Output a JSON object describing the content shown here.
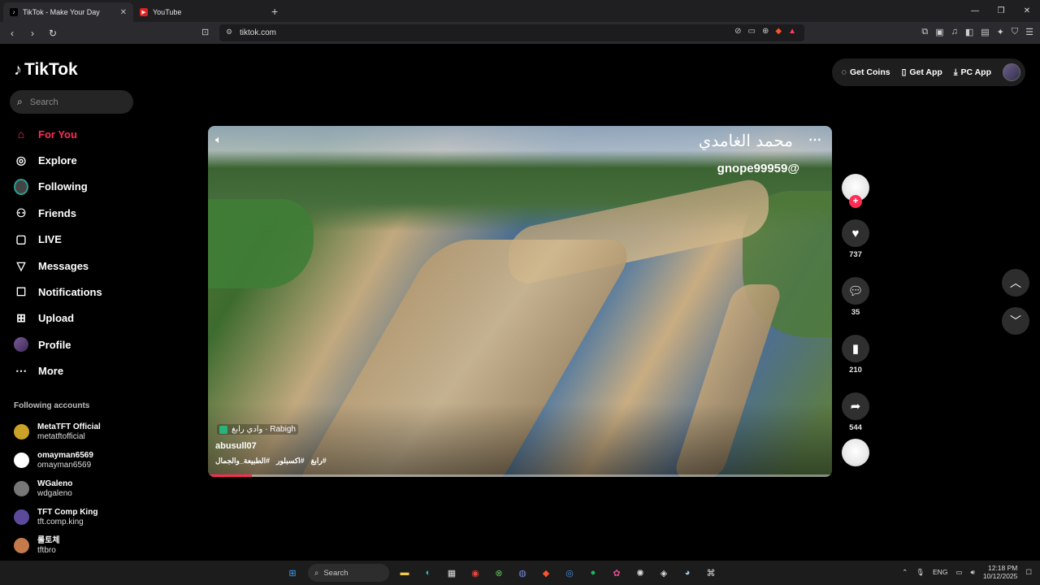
{
  "browser": {
    "tabs": [
      {
        "title": "TikTok - Make Your Day",
        "active": true
      },
      {
        "title": "YouTube",
        "active": false
      }
    ],
    "url": "tiktok.com"
  },
  "app": {
    "logo": "TikTok",
    "search_placeholder": "Search"
  },
  "nav": {
    "items": [
      {
        "label": "For You",
        "icon": "home-icon"
      },
      {
        "label": "Explore",
        "icon": "compass-icon"
      },
      {
        "label": "Following",
        "icon": "following-avatar-icon"
      },
      {
        "label": "Friends",
        "icon": "friends-icon"
      },
      {
        "label": "LIVE",
        "icon": "live-icon"
      },
      {
        "label": "Messages",
        "icon": "message-icon"
      },
      {
        "label": "Notifications",
        "icon": "notification-icon"
      },
      {
        "label": "Upload",
        "icon": "upload-icon"
      },
      {
        "label": "Profile",
        "icon": "profile-avatar-icon"
      },
      {
        "label": "More",
        "icon": "more-icon"
      }
    ]
  },
  "following": {
    "title": "Following accounts",
    "accounts": [
      {
        "name": "MetaTFT Official",
        "user": "metatftofficial"
      },
      {
        "name": "omayman6569",
        "user": "omayman6569"
      },
      {
        "name": "WGaleno",
        "user": "wdgaleno"
      },
      {
        "name": "TFT Comp King",
        "user": "tft.comp.king"
      },
      {
        "name": "롤토체",
        "user": "tftbro"
      }
    ]
  },
  "topbar": {
    "coins": "Get Coins",
    "app": "Get App",
    "pc": "PC App"
  },
  "video": {
    "overlay_name": "محمد الغامدي",
    "overlay_handle": "gnope99959@",
    "location": "وادي رابغ · Rabigh",
    "author": "abusull07",
    "tags": [
      "#الطبيعة_والجمال",
      "#اكسبلور",
      "#رابغ"
    ],
    "progress": 0.07
  },
  "actions": {
    "likes": "737",
    "comments": "35",
    "saves": "210",
    "shares": "544"
  },
  "taskbar": {
    "search": "Search",
    "lang": "ENG",
    "time": "12:18 PM",
    "date": "10/12/2025"
  }
}
